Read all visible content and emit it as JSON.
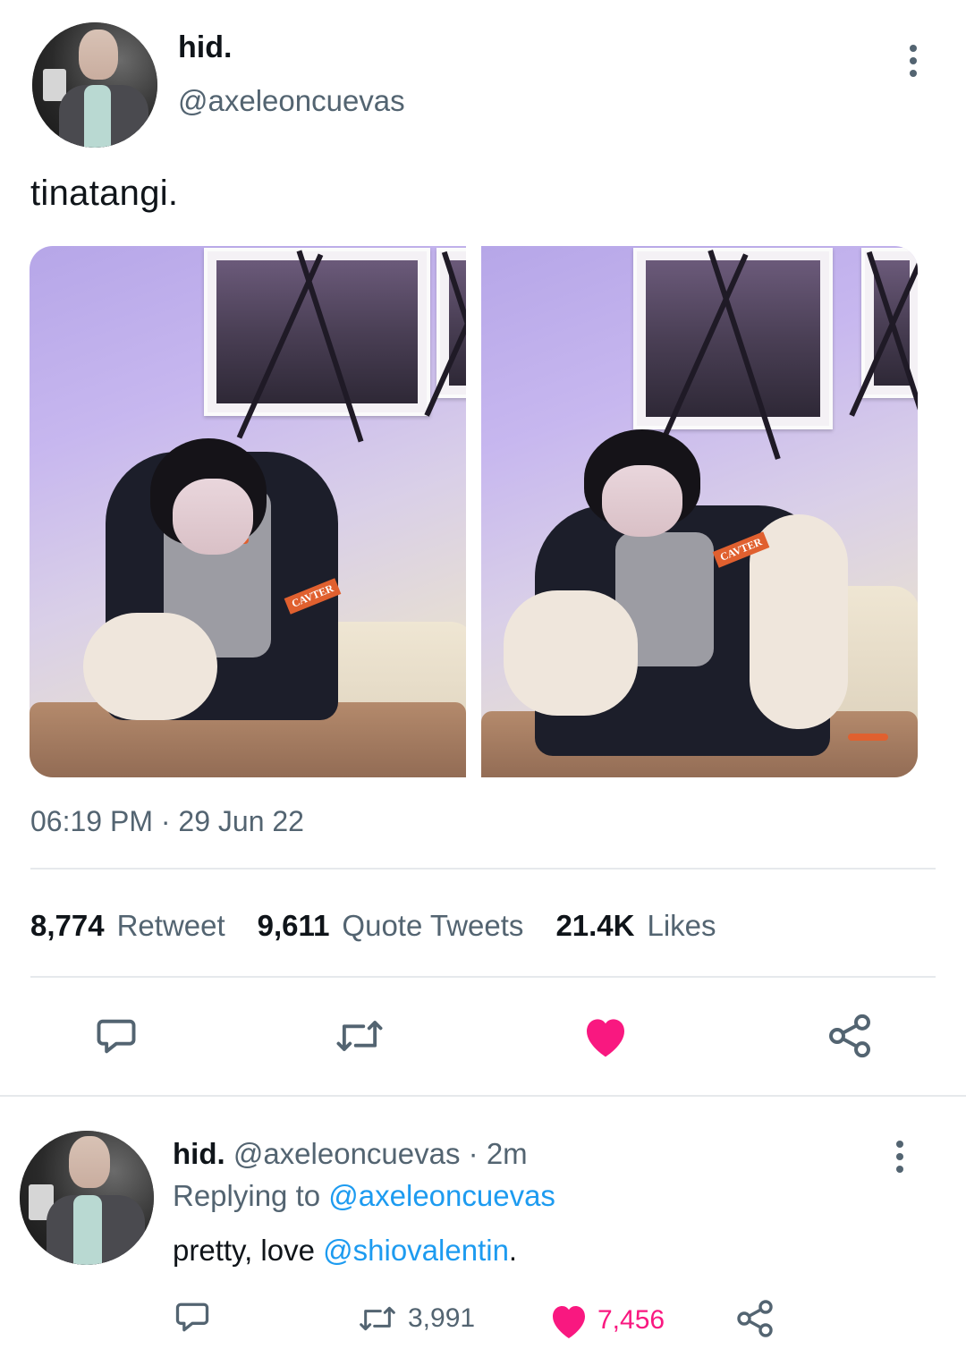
{
  "tweet": {
    "author_name": "hid.",
    "author_handle": "@axeleoncuevas",
    "text": "tinatangi.",
    "timestamp": "06:19 PM · 29 Jun 22",
    "stats": {
      "retweets_count": "8,774",
      "retweets_label": "Retweet",
      "quotes_count": "9,611",
      "quotes_label": "Quote Tweets",
      "likes_count": "21.4K",
      "likes_label": "Likes"
    },
    "photos": [
      {
        "patch_text": "CAVTER"
      },
      {
        "patch_text": "CAVTER"
      }
    ],
    "liked": true
  },
  "reply": {
    "author_name": "hid.",
    "author_handle": "@axeleoncuevas",
    "time": "· 2m",
    "replying_prefix": "Replying to",
    "replying_handle": "@axeleoncuevas",
    "text_before": "pretty, love",
    "mention": "@shiovalentin",
    "text_after": ".",
    "retweet_count": "3,991",
    "like_count": "7,456"
  },
  "colors": {
    "accent_blue": "#1d9bf0",
    "like_pink": "#f91880",
    "secondary_text": "#536471"
  },
  "icons": [
    "kebab-icon",
    "reply-icon",
    "retweet-icon",
    "heart-icon",
    "share-icon"
  ]
}
